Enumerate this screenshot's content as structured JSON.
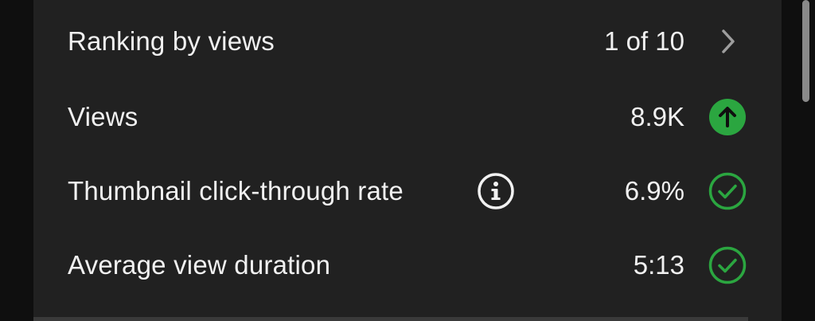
{
  "metrics": {
    "ranking": {
      "label": "Ranking by views",
      "value": "1 of 10",
      "icon": "chevron-right-icon"
    },
    "views": {
      "label": "Views",
      "value": "8.9K",
      "status_icon": "arrow-up-circle-icon",
      "status_color": "#2ba640"
    },
    "ctr": {
      "label": "Thumbnail click-through rate",
      "value": "6.9%",
      "info_icon": "info-circle-icon",
      "status_icon": "check-circle-icon",
      "status_color": "#2ba640"
    },
    "avd": {
      "label": "Average view duration",
      "value": "5:13",
      "status_icon": "check-circle-icon",
      "status_color": "#2ba640"
    }
  },
  "theme": {
    "background": "#0f0f0f",
    "card": "#212121",
    "text": "#f1f1f1",
    "positive": "#2ba640"
  }
}
